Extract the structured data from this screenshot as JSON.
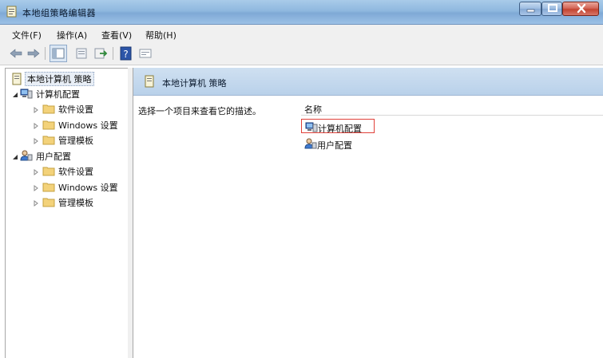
{
  "window": {
    "title": "本地组策略编辑器"
  },
  "menu": {
    "file": "文件(F)",
    "action": "操作(A)",
    "view": "查看(V)",
    "help": "帮助(H)"
  },
  "tree": {
    "root": "本地计算机 策略",
    "computer_config": "计算机配置",
    "user_config": "用户配置",
    "computer_children": [
      "软件设置",
      "Windows 设置",
      "管理模板"
    ],
    "user_children": [
      "软件设置",
      "Windows 设置",
      "管理模板"
    ]
  },
  "right_pane": {
    "header_title": "本地计算机 策略",
    "description": "选择一个项目来查看它的描述。",
    "column_name": "名称",
    "items": [
      "计算机配置",
      "用户配置"
    ]
  },
  "colors": {
    "selection_highlight": "#e0413a",
    "header_blue": "#b9d1ea",
    "title_bar": "#8fb8df"
  }
}
